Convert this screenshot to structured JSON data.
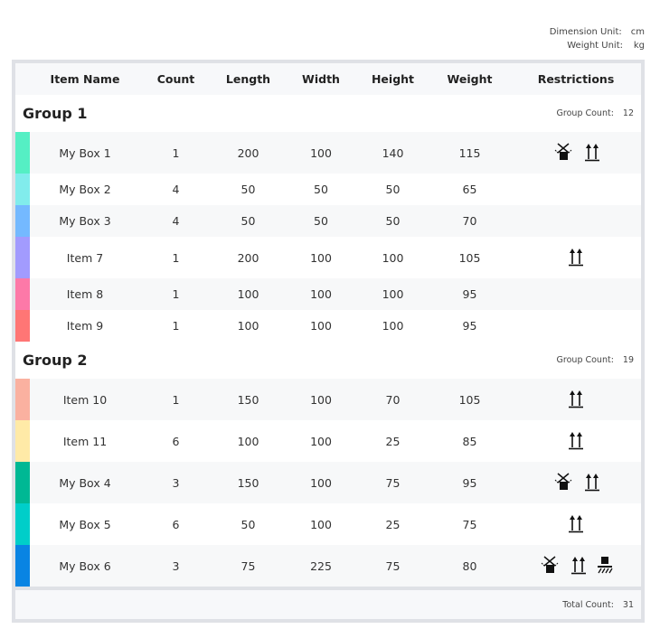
{
  "units": {
    "dimension_label": "Dimension Unit:",
    "dimension_value": "cm",
    "weight_label": "Weight Unit:",
    "weight_value": "kg"
  },
  "columns": [
    "Item Name",
    "Count",
    "Length",
    "Width",
    "Height",
    "Weight",
    "Restrictions"
  ],
  "group_count_label": "Group Count:",
  "groups": [
    {
      "name": "Group 1",
      "count": "12",
      "items": [
        {
          "name": "My Box 1",
          "count": "1",
          "length": "200",
          "width": "100",
          "height": "140",
          "weight": "115",
          "color": "#55efc4",
          "restrictions": [
            "no-tilt",
            "this-side-up"
          ]
        },
        {
          "name": "My Box 2",
          "count": "4",
          "length": "50",
          "width": "50",
          "height": "50",
          "weight": "65",
          "color": "#81ecec",
          "restrictions": []
        },
        {
          "name": "My Box 3",
          "count": "4",
          "length": "50",
          "width": "50",
          "height": "50",
          "weight": "70",
          "color": "#74b9ff",
          "restrictions": []
        },
        {
          "name": "Item 7",
          "count": "1",
          "length": "200",
          "width": "100",
          "height": "100",
          "weight": "105",
          "color": "#a29bfe",
          "restrictions": [
            "this-side-up"
          ]
        },
        {
          "name": "Item 8",
          "count": "1",
          "length": "100",
          "width": "100",
          "height": "100",
          "weight": "95",
          "color": "#fd79a8",
          "restrictions": []
        },
        {
          "name": "Item 9",
          "count": "1",
          "length": "100",
          "width": "100",
          "height": "100",
          "weight": "95",
          "color": "#ff7675",
          "restrictions": []
        }
      ]
    },
    {
      "name": "Group 2",
      "count": "19",
      "items": [
        {
          "name": "Item 10",
          "count": "1",
          "length": "150",
          "width": "100",
          "height": "70",
          "weight": "105",
          "color": "#fab1a0",
          "restrictions": [
            "this-side-up"
          ]
        },
        {
          "name": "Item 11",
          "count": "6",
          "length": "100",
          "width": "100",
          "height": "25",
          "weight": "85",
          "color": "#ffeaa7",
          "restrictions": [
            "this-side-up"
          ]
        },
        {
          "name": "My Box 4",
          "count": "3",
          "length": "150",
          "width": "100",
          "height": "75",
          "weight": "95",
          "color": "#00b894",
          "restrictions": [
            "no-tilt",
            "this-side-up"
          ]
        },
        {
          "name": "My Box 5",
          "count": "6",
          "length": "50",
          "width": "100",
          "height": "25",
          "weight": "75",
          "color": "#00cec9",
          "restrictions": [
            "this-side-up"
          ]
        },
        {
          "name": "My Box 6",
          "count": "3",
          "length": "75",
          "width": "225",
          "height": "75",
          "weight": "80",
          "color": "#0984e3",
          "restrictions": [
            "no-tilt",
            "this-side-up",
            "bottom-only"
          ]
        }
      ]
    }
  ],
  "footer": {
    "total_label": "Total Count:",
    "total_value": "31"
  }
}
